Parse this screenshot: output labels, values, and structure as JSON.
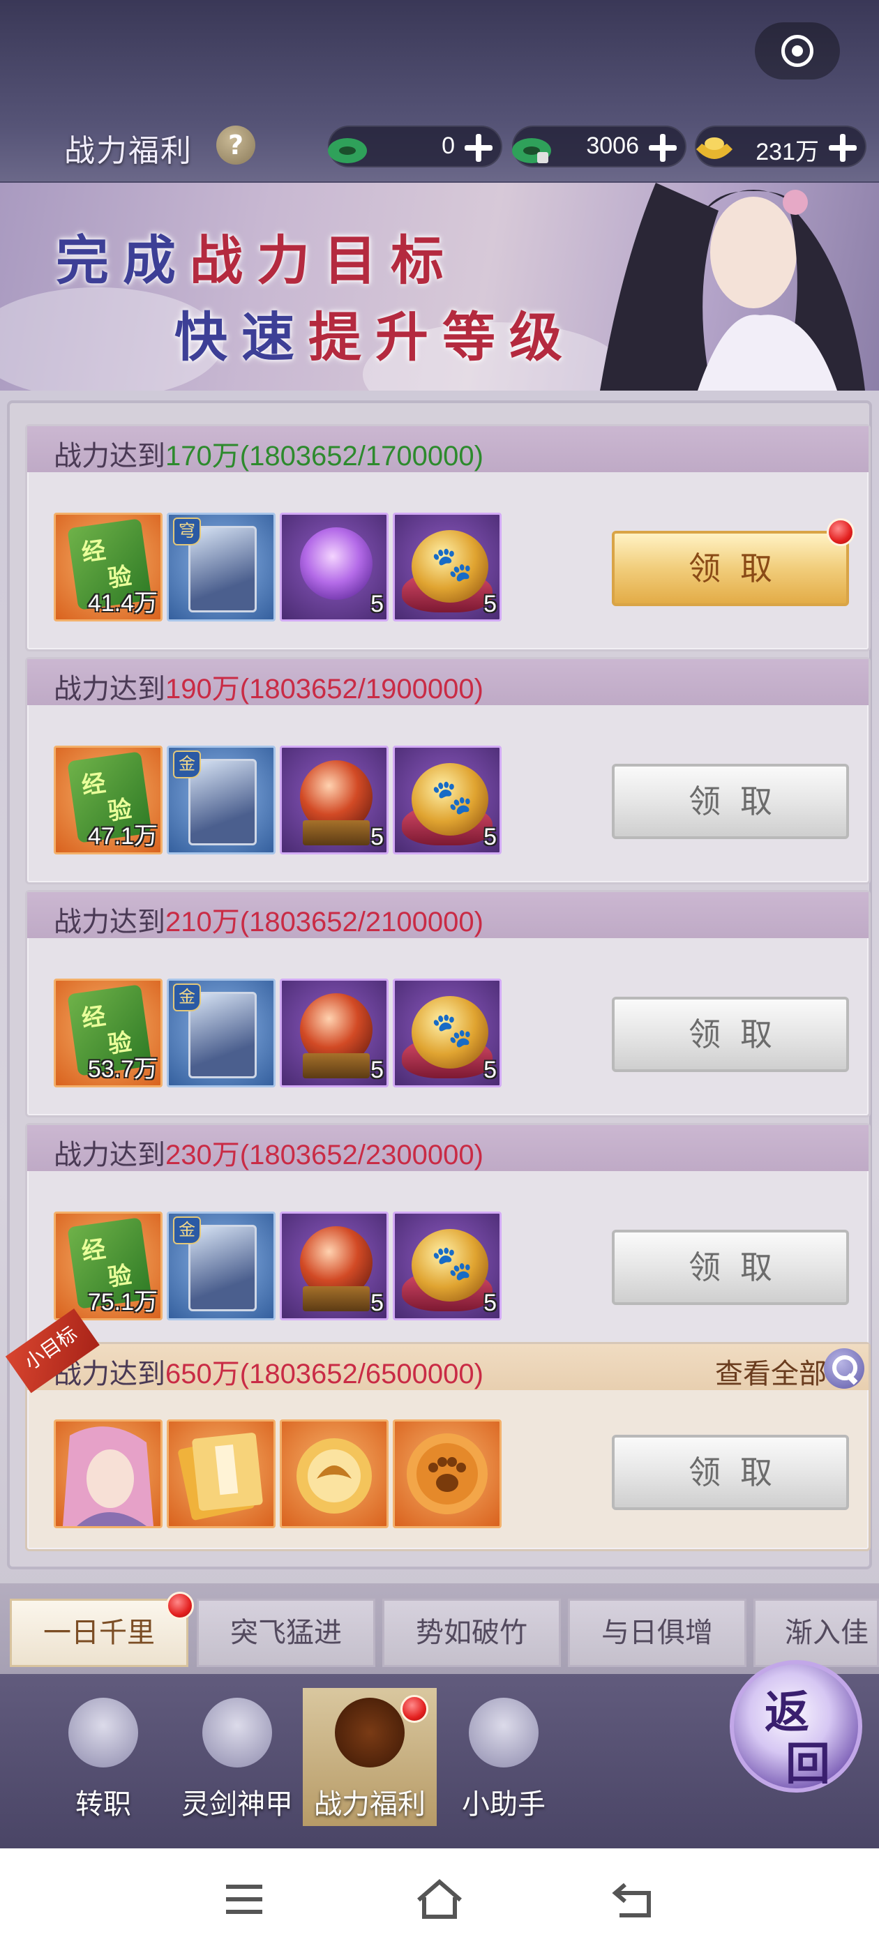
{
  "header": {
    "title": "战力福利",
    "help_icon": "question-icon",
    "currencies": [
      {
        "icon": "green-jade-icon",
        "value": "0"
      },
      {
        "icon": "bound-jade-icon",
        "value": "3006"
      },
      {
        "icon": "gold-ingot-icon",
        "value": "231万"
      }
    ]
  },
  "banner": {
    "line1": [
      {
        "text": "完成",
        "color": "blue"
      },
      {
        "text": "战力目标",
        "color": "red"
      }
    ],
    "line2": [
      {
        "text": "快速",
        "color": "blue"
      },
      {
        "text": "提升等级",
        "color": "red"
      }
    ]
  },
  "rewards": [
    {
      "prefix": "战力达到",
      "target": "170万",
      "progress": "(1803652/1700000)",
      "reached": true,
      "items": [
        {
          "type": "exp-scroll",
          "count": "41.4万"
        },
        {
          "type": "hero-card",
          "tag": "穹",
          "count": ""
        },
        {
          "type": "purple-orb",
          "count": "5"
        },
        {
          "type": "paw-stone",
          "count": "5"
        }
      ],
      "button": "领取",
      "button_active": true,
      "has_dot": true
    },
    {
      "prefix": "战力达到",
      "target": "190万",
      "progress": "(1803652/1900000)",
      "reached": false,
      "items": [
        {
          "type": "exp-scroll",
          "count": "47.1万"
        },
        {
          "type": "hero-card",
          "tag": "金",
          "count": ""
        },
        {
          "type": "red-orb",
          "count": "5"
        },
        {
          "type": "paw-stone",
          "count": "5"
        }
      ],
      "button": "领取",
      "button_active": false,
      "has_dot": false
    },
    {
      "prefix": "战力达到",
      "target": "210万",
      "progress": "(1803652/2100000)",
      "reached": false,
      "items": [
        {
          "type": "exp-scroll",
          "count": "53.7万"
        },
        {
          "type": "hero-card",
          "tag": "金",
          "count": ""
        },
        {
          "type": "red-orb",
          "count": "5"
        },
        {
          "type": "paw-stone",
          "count": "5"
        }
      ],
      "button": "领取",
      "button_active": false,
      "has_dot": false
    },
    {
      "prefix": "战力达到",
      "target": "230万",
      "progress": "(1803652/2300000)",
      "reached": false,
      "items": [
        {
          "type": "exp-scroll",
          "count": "75.1万"
        },
        {
          "type": "hero-card",
          "tag": "金",
          "count": ""
        },
        {
          "type": "red-orb",
          "count": "5"
        },
        {
          "type": "paw-stone",
          "count": "5"
        }
      ],
      "button": "领取",
      "button_active": false,
      "has_dot": false
    },
    {
      "prefix": "战力达到",
      "target": "650万",
      "progress": "(1803652/6500000)",
      "reached": false,
      "ribbon": "小目标",
      "view_all": "查看全部",
      "items": [
        {
          "type": "hero-portrait",
          "count": ""
        },
        {
          "type": "book",
          "count": ""
        },
        {
          "type": "dragon-medal",
          "count": ""
        },
        {
          "type": "paw-medal",
          "count": ""
        }
      ],
      "button": "领取",
      "button_active": false,
      "has_dot": false
    }
  ],
  "tabs": [
    {
      "label": "一日千里",
      "active": true,
      "has_dot": true
    },
    {
      "label": "突飞猛进",
      "active": false
    },
    {
      "label": "势如破竹",
      "active": false
    },
    {
      "label": "与日俱增",
      "active": false
    },
    {
      "label": "渐入佳",
      "active": false
    }
  ],
  "bottom_nav": [
    {
      "label": "转职",
      "icon": "class-change-icon",
      "active": false
    },
    {
      "label": "灵剑神甲",
      "icon": "sword-armor-icon",
      "active": false
    },
    {
      "label": "战力福利",
      "icon": "flame-icon",
      "active": true,
      "has_dot": true
    },
    {
      "label": "小助手",
      "icon": "helper-icon",
      "active": false
    }
  ],
  "return_button": {
    "chars": [
      "返",
      "回"
    ]
  },
  "system_nav": [
    "menu-icon",
    "home-icon",
    "back-icon"
  ],
  "colors": {
    "reached": "#2d8a2d",
    "unreached": "#c92b45",
    "gold_button": "#f1cd7b"
  }
}
